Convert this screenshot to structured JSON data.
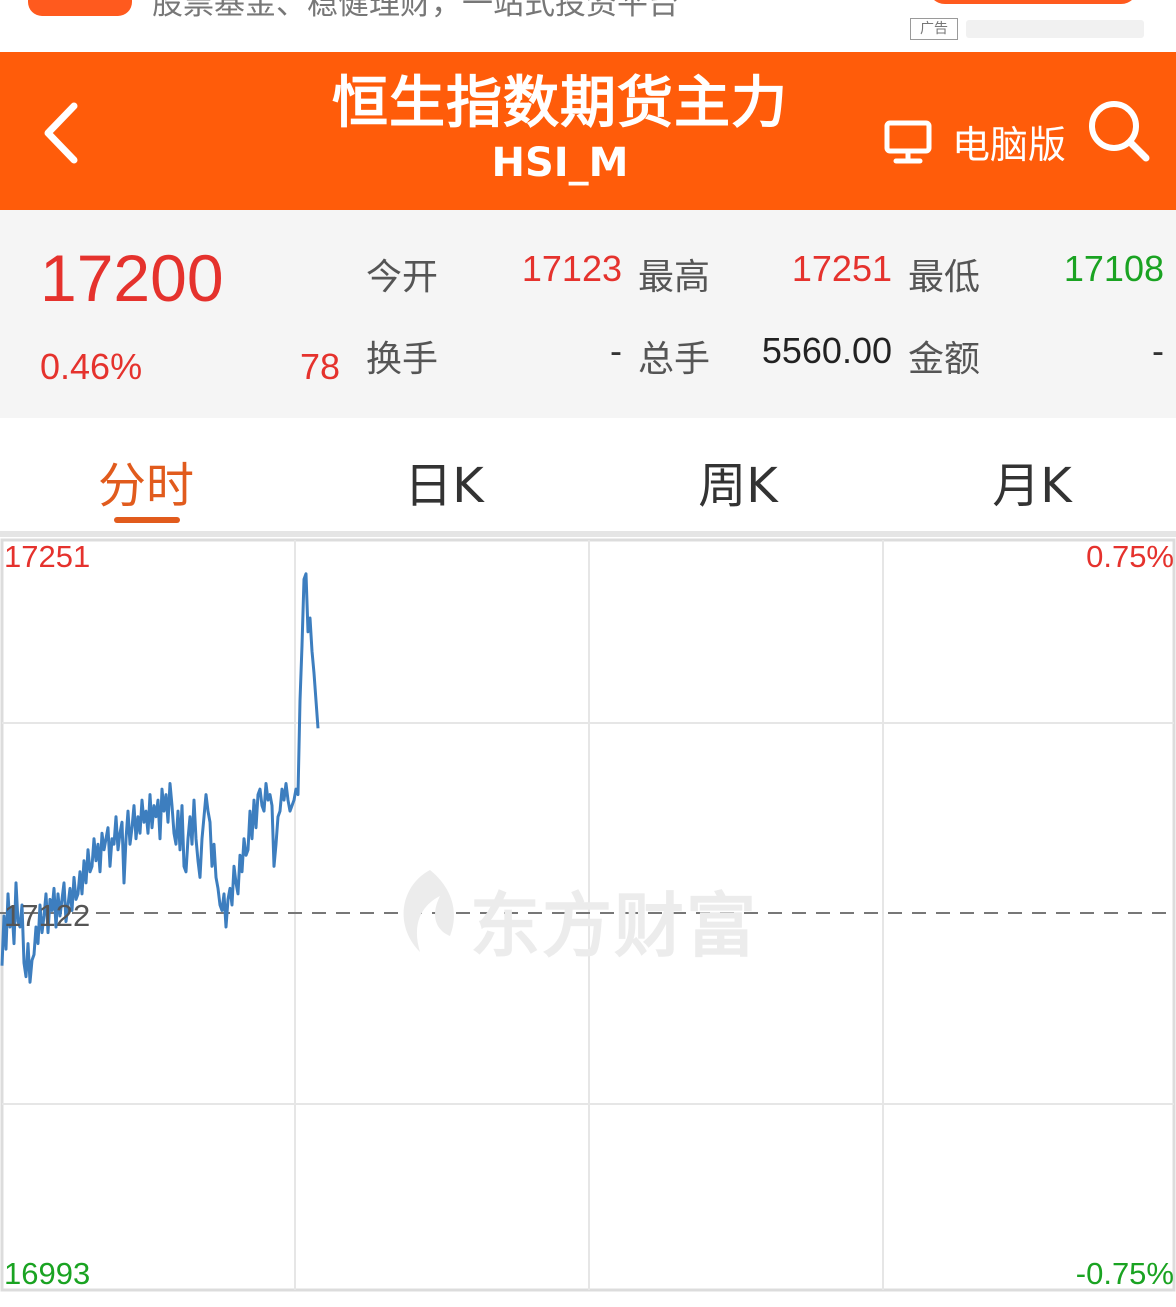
{
  "ad": {
    "tag": "广告",
    "text": "股票基金、稳健理财，一站式投资平台"
  },
  "header": {
    "title": "恒生指数期货主力",
    "subtitle": "HSI_M",
    "pc_label": "电脑版",
    "icons": [
      "back-arrow-icon",
      "monitor-icon",
      "search-icon"
    ]
  },
  "quote": {
    "price": "17200",
    "change_pct": "0.46%",
    "change": "78",
    "open_label": "今开",
    "open": "17123",
    "high_label": "最高",
    "high": "17251",
    "low_label": "最低",
    "low": "17108",
    "turnover_label": "换手",
    "turnover": "-",
    "volume_label": "总手",
    "volume": "5560.00",
    "amount_label": "金额",
    "amount": "-",
    "colors": {
      "up": "#e5322d",
      "down": "#1aa322"
    }
  },
  "tabs": [
    {
      "label": "分时",
      "active": true
    },
    {
      "label": "日K",
      "active": false
    },
    {
      "label": "周K",
      "active": false
    },
    {
      "label": "月K",
      "active": false
    }
  ],
  "watermark": "东方财富",
  "chart_data": {
    "type": "line",
    "title": "",
    "y_max_label": "17251",
    "y_min_label": "16993",
    "y_prev_close_label": "17122",
    "right_max_label": "0.75%",
    "right_min_label": "-0.75%",
    "ylim": [
      16993,
      17251
    ],
    "prev_close": 17122,
    "line_color": "#3d7ebf",
    "x": [
      0,
      2,
      4,
      6,
      8,
      10,
      12,
      14,
      16,
      18,
      20,
      22,
      24,
      26,
      28,
      30,
      32,
      34,
      36,
      38,
      40,
      42,
      44,
      46,
      48,
      50,
      52,
      54,
      56,
      58,
      60,
      62,
      64,
      66,
      68,
      70,
      72,
      74,
      76,
      78,
      80,
      82,
      84,
      86,
      88,
      90,
      92,
      94,
      96,
      98,
      100,
      102,
      104,
      106,
      108,
      110,
      112,
      114,
      116,
      118,
      120,
      122,
      124,
      126,
      128,
      130,
      132,
      134,
      136,
      138,
      140,
      142,
      144,
      146,
      148,
      150,
      152,
      154,
      156,
      158,
      160,
      162,
      164,
      166,
      168,
      170,
      172,
      174,
      176,
      178,
      180,
      182,
      184,
      186,
      188,
      190,
      192,
      194,
      196,
      198,
      200,
      202,
      204,
      206,
      208,
      210,
      212,
      214,
      216,
      218,
      220,
      222,
      224,
      226,
      228,
      230,
      232,
      234,
      236,
      238,
      240,
      242,
      244,
      246,
      248,
      250,
      252,
      254,
      256,
      258,
      260,
      262,
      264,
      266,
      268,
      270,
      272,
      274,
      276,
      278,
      280,
      282,
      284,
      286,
      288,
      290,
      292,
      294,
      296,
      298,
      300,
      302,
      304,
      306,
      308,
      310,
      312,
      314,
      316,
      318,
      320
    ],
    "series": [
      {
        "values": [
          17104,
          17122,
          17110,
          17130,
          17118,
          17125,
          17112,
          17134,
          17120,
          17118,
          17126,
          17105,
          17100,
          17112,
          17098,
          17106,
          17108,
          17118,
          17112,
          17126,
          17116,
          17122,
          17130,
          17116,
          17128,
          17124,
          17132,
          17118,
          17130,
          17122,
          17128,
          17134,
          17120,
          17126,
          17132,
          17124,
          17136,
          17128,
          17130,
          17138,
          17130,
          17142,
          17134,
          17146,
          17138,
          17140,
          17150,
          17142,
          17148,
          17138,
          17152,
          17146,
          17150,
          17154,
          17140,
          17150,
          17148,
          17158,
          17146,
          17152,
          17156,
          17134,
          17150,
          17160,
          17148,
          17154,
          17162,
          17150,
          17158,
          17152,
          17164,
          17156,
          17160,
          17152,
          17166,
          17154,
          17162,
          17158,
          17164,
          17150,
          17168,
          17160,
          17166,
          17156,
          17170,
          17162,
          17152,
          17148,
          17160,
          17146,
          17162,
          17140,
          17138,
          17150,
          17158,
          17148,
          17164,
          17150,
          17142,
          17136,
          17150,
          17158,
          17166,
          17160,
          17156,
          17140,
          17148,
          17136,
          17132,
          17126,
          17124,
          17130,
          17118,
          17128,
          17132,
          17126,
          17140,
          17134,
          17130,
          17144,
          17138,
          17150,
          17144,
          17146,
          17160,
          17150,
          17164,
          17154,
          17166,
          17168,
          17162,
          17160,
          17170,
          17164,
          17166,
          17162,
          17140,
          17148,
          17158,
          17160,
          17168,
          17164,
          17170,
          17164,
          17160,
          17162,
          17164,
          17168,
          17166,
          17200,
          17220,
          17244,
          17246,
          17225,
          17230,
          17218,
          17210,
          17200,
          17190
        ],
        "x_offset_units": 0
      }
    ],
    "grid": true
  }
}
